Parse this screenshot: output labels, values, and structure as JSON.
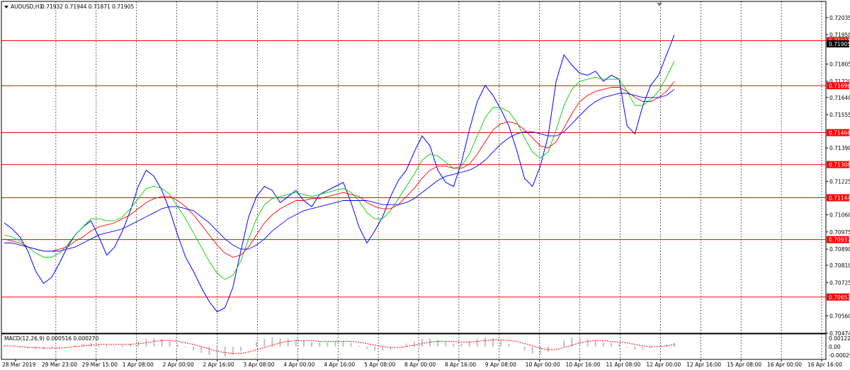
{
  "header": {
    "symbol": "AUDUSD,H1",
    "ohlc": "0.71932 0.71944 0.71871 0.71905"
  },
  "macd": {
    "label": "MACD(12,26,9) 0.000516 0.000270",
    "scale_top": "0.001228",
    "scale_mid": "0.00",
    "scale_bottom": "-0.000296",
    "color_signal": "#ff0000",
    "color_hist": "#c0c0c0"
  },
  "colors": {
    "price_line": "#0000ff",
    "ma_fast": "#00cc00",
    "ma_mid": "#ff0000",
    "ma_slow": "#0000ff",
    "hline": "#ff0000",
    "price_tag_bg": "#ff0000",
    "current_tag_bg": "#000000",
    "grid": "#000000"
  },
  "chart_data": {
    "type": "line",
    "title": "AUDUSD,H1",
    "ylim": [
      0.70474,
      0.72115
    ],
    "y_ticks": [
      "0.72035",
      "0.71950",
      "0.71805",
      "0.71720",
      "0.71640",
      "0.71555",
      "0.71390",
      "0.71225",
      "0.71060",
      "0.70975",
      "0.70890",
      "0.70810",
      "0.70725",
      "0.70560",
      "0.70474"
    ],
    "x_ticks": [
      "28 Mar 2019",
      "28 Mar 23:00",
      "29 Mar 15:00",
      "1 Apr 08:00",
      "2 Apr 00:00",
      "2 Apr 16:00",
      "3 Apr 08:00",
      "4 Apr 00:00",
      "4 Apr 16:00",
      "5 Apr 08:00",
      "8 Apr 00:00",
      "8 Apr 16:00",
      "9 Apr 08:00",
      "10 Apr 00:00",
      "10 Apr 16:00",
      "11 Apr 08:00",
      "12 Apr 00:00",
      "12 Apr 16:00",
      "15 Apr 08:00",
      "16 Apr 00:00",
      "16 Apr 16:00"
    ],
    "horizontal_levels": [
      0.71921,
      0.71698,
      0.71466,
      0.71308,
      0.71144,
      0.70937,
      0.70653
    ],
    "horizontal_labels": [
      "0.71921",
      "0.71698",
      "0.71466",
      "0.71308",
      "0.71144",
      "0.70937",
      "0.70653"
    ],
    "current_price": "0.71905",
    "series": [
      {
        "values": [
          0.7102,
          0.7099,
          0.7095,
          0.7088,
          0.7078,
          0.7072,
          0.7075,
          0.7082,
          0.709,
          0.7096,
          0.71,
          0.7103,
          0.7095,
          0.7086,
          0.709,
          0.7098,
          0.7108,
          0.712,
          0.7128,
          0.7125,
          0.7118,
          0.7108,
          0.7096,
          0.7085,
          0.7078,
          0.707,
          0.7063,
          0.7058,
          0.706,
          0.707,
          0.7088,
          0.7105,
          0.7115,
          0.712,
          0.7118,
          0.7112,
          0.7115,
          0.7118,
          0.7113,
          0.711,
          0.7116,
          0.7118,
          0.712,
          0.7122,
          0.7112,
          0.71,
          0.7092,
          0.7098,
          0.7105,
          0.7115,
          0.7123,
          0.7128,
          0.7137,
          0.7145,
          0.714,
          0.7128,
          0.7122,
          0.712,
          0.7132,
          0.7148,
          0.7162,
          0.717,
          0.7165,
          0.7158,
          0.715,
          0.7138,
          0.7124,
          0.712,
          0.713,
          0.7145,
          0.7172,
          0.7185,
          0.718,
          0.7176,
          0.7175,
          0.7177,
          0.7172,
          0.7175,
          0.7173,
          0.715,
          0.7146,
          0.716,
          0.717,
          0.7175,
          0.7185,
          0.7195
        ]
      },
      {
        "values": [
          0.7096,
          0.7095,
          0.7093,
          0.709,
          0.7087,
          0.7085,
          0.7085,
          0.7087,
          0.7091,
          0.7096,
          0.71,
          0.7104,
          0.7104,
          0.7103,
          0.7103,
          0.7105,
          0.7109,
          0.7114,
          0.7119,
          0.712,
          0.7119,
          0.7116,
          0.711,
          0.7104,
          0.7097,
          0.709,
          0.7083,
          0.7077,
          0.7074,
          0.7076,
          0.7083,
          0.7094,
          0.7104,
          0.7111,
          0.7114,
          0.7115,
          0.7116,
          0.7117,
          0.7116,
          0.7115,
          0.7116,
          0.7117,
          0.7118,
          0.7119,
          0.7117,
          0.7113,
          0.7107,
          0.7104,
          0.7104,
          0.7108,
          0.7114,
          0.712,
          0.7126,
          0.7133,
          0.7136,
          0.7135,
          0.7132,
          0.7129,
          0.713,
          0.7136,
          0.7145,
          0.7154,
          0.7159,
          0.7159,
          0.7157,
          0.7152,
          0.7144,
          0.7137,
          0.7134,
          0.7137,
          0.7148,
          0.716,
          0.7168,
          0.7172,
          0.7173,
          0.7174,
          0.7173,
          0.7173,
          0.7173,
          0.7167,
          0.716,
          0.716,
          0.7163,
          0.7167,
          0.7174,
          0.7182
        ]
      },
      {
        "values": [
          0.7094,
          0.7093,
          0.7092,
          0.709,
          0.7089,
          0.7088,
          0.7088,
          0.7089,
          0.709,
          0.7093,
          0.7095,
          0.7098,
          0.71,
          0.7101,
          0.7102,
          0.7104,
          0.7106,
          0.7109,
          0.7112,
          0.7114,
          0.7115,
          0.7115,
          0.7113,
          0.711,
          0.7106,
          0.7101,
          0.7096,
          0.7091,
          0.7087,
          0.7085,
          0.7086,
          0.709,
          0.7096,
          0.7102,
          0.7106,
          0.7109,
          0.7111,
          0.7113,
          0.7113,
          0.7114,
          0.7114,
          0.7115,
          0.7116,
          0.7117,
          0.7116,
          0.7115,
          0.7112,
          0.711,
          0.7109,
          0.7109,
          0.7111,
          0.7115,
          0.7119,
          0.7124,
          0.7128,
          0.713,
          0.713,
          0.7129,
          0.7129,
          0.7131,
          0.7136,
          0.7142,
          0.7148,
          0.7151,
          0.7152,
          0.7151,
          0.7148,
          0.7144,
          0.714,
          0.7139,
          0.7142,
          0.7149,
          0.7156,
          0.7162,
          0.7165,
          0.7167,
          0.7168,
          0.7169,
          0.7169,
          0.7167,
          0.7164,
          0.7162,
          0.7162,
          0.7164,
          0.7167,
          0.7172
        ]
      },
      {
        "values": [
          0.7092,
          0.7092,
          0.7091,
          0.709,
          0.7089,
          0.7088,
          0.7088,
          0.7088,
          0.7089,
          0.709,
          0.7092,
          0.7094,
          0.7096,
          0.7097,
          0.7098,
          0.7099,
          0.7101,
          0.7103,
          0.7105,
          0.7107,
          0.7109,
          0.711,
          0.711,
          0.7109,
          0.7108,
          0.7105,
          0.7102,
          0.7098,
          0.7094,
          0.7091,
          0.7089,
          0.7089,
          0.7091,
          0.7094,
          0.7098,
          0.7101,
          0.7104,
          0.7106,
          0.7108,
          0.7109,
          0.711,
          0.7111,
          0.7112,
          0.7113,
          0.7113,
          0.7113,
          0.7113,
          0.7112,
          0.7111,
          0.7111,
          0.7111,
          0.7112,
          0.7114,
          0.7117,
          0.712,
          0.7123,
          0.7125,
          0.7126,
          0.7127,
          0.7128,
          0.713,
          0.7133,
          0.7137,
          0.7141,
          0.7144,
          0.7146,
          0.7147,
          0.7147,
          0.7146,
          0.7145,
          0.7145,
          0.7147,
          0.7151,
          0.7155,
          0.7159,
          0.7162,
          0.7164,
          0.7165,
          0.7166,
          0.7166,
          0.7165,
          0.7164,
          0.7164,
          0.7164,
          0.7165,
          0.7168
        ]
      }
    ],
    "macd_hist": [
      0.0001,
      0.0,
      -0.0001,
      -0.0002,
      -0.0003,
      -0.0003,
      -0.0002,
      -0.0001,
      0.0,
      0.0002,
      0.0004,
      0.0005,
      0.0004,
      0.0002,
      0.0001,
      0.0002,
      0.0004,
      0.0007,
      0.001,
      0.0011,
      0.001,
      0.0007,
      0.0003,
      -0.0001,
      -0.0005,
      -0.0008,
      -0.0011,
      -0.0013,
      -0.0013,
      -0.0011,
      -0.0006,
      0.0,
      0.0006,
      0.001,
      0.0012,
      0.0011,
      0.001,
      0.0009,
      0.0008,
      0.0006,
      0.0006,
      0.0006,
      0.0007,
      0.0007,
      0.0005,
      0.0001,
      -0.0003,
      -0.0005,
      -0.0005,
      -0.0003,
      0.0,
      0.0004,
      0.0007,
      0.001,
      0.0011,
      0.0009,
      0.0006,
      0.0004,
      0.0004,
      0.0007,
      0.001,
      0.0012,
      0.0011,
      0.0008,
      0.0004,
      0.0,
      -0.0005,
      -0.0009,
      -0.001,
      -0.0007,
      0.0,
      0.0008,
      0.0012,
      0.0012,
      0.001,
      0.0008,
      0.0006,
      0.0005,
      0.0004,
      -0.0001,
      -0.0004,
      -0.0004,
      -0.0002,
      0.0,
      0.0003,
      0.0005
    ],
    "macd_signal": [
      0.0001,
      0.0001,
      0.0,
      -0.0001,
      -0.0001,
      -0.0002,
      -0.0002,
      -0.0002,
      -0.0001,
      0.0,
      0.0001,
      0.0002,
      0.0003,
      0.0003,
      0.0003,
      0.0003,
      0.0003,
      0.0004,
      0.0005,
      0.0007,
      0.0008,
      0.0008,
      0.0007,
      0.0005,
      0.0003,
      0.0,
      -0.0003,
      -0.0006,
      -0.0008,
      -0.0009,
      -0.0009,
      -0.0007,
      -0.0004,
      -0.0001,
      0.0002,
      0.0005,
      0.0007,
      0.0008,
      0.0008,
      0.0008,
      0.0007,
      0.0007,
      0.0007,
      0.0007,
      0.0007,
      0.0006,
      0.0004,
      0.0002,
      0.0,
      -0.0001,
      -0.0001,
      0.0,
      0.0002,
      0.0004,
      0.0006,
      0.0007,
      0.0007,
      0.0007,
      0.0006,
      0.0006,
      0.0007,
      0.0008,
      0.0009,
      0.0009,
      0.0008,
      0.0007,
      0.0004,
      0.0001,
      -0.0002,
      -0.0004,
      -0.0004,
      -0.0001,
      0.0002,
      0.0005,
      0.0007,
      0.0008,
      0.0008,
      0.0007,
      0.0006,
      0.0005,
      0.0003,
      0.0001,
      0.0,
      0.0,
      0.0001,
      0.0003
    ]
  }
}
